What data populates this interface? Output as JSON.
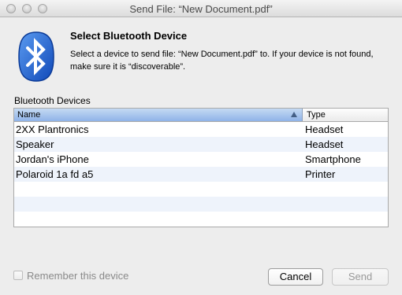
{
  "window": {
    "title": "Send File: “New Document.pdf”"
  },
  "header": {
    "heading": "Select Bluetooth Device",
    "description": "Select a device to send file: “New Document.pdf” to.  If your device is not found, make sure it is “discoverable”.",
    "icon": "bluetooth-icon"
  },
  "devices": {
    "label": "Bluetooth Devices",
    "columns": {
      "name": "Name",
      "type": "Type"
    },
    "sort": {
      "column": "name",
      "direction": "ascending",
      "icon": "sort-ascending-icon"
    },
    "rows": [
      {
        "name": "2XX Plantronics",
        "type": "Headset"
      },
      {
        "name": "Speaker",
        "type": "Headset"
      },
      {
        "name": "Jordan's iPhone",
        "type": "Smartphone"
      },
      {
        "name": "Polaroid 1a fd a5",
        "type": "Printer"
      },
      {
        "name": "",
        "type": ""
      },
      {
        "name": "",
        "type": ""
      },
      {
        "name": "",
        "type": ""
      }
    ]
  },
  "footer": {
    "remember_label": "Remember this device",
    "remember_checked": false,
    "cancel_label": "Cancel",
    "send_label": "Send",
    "send_enabled": false
  },
  "colors": {
    "bluetooth_blue": "#1c5fd1",
    "selected_header": "#8fb3e8",
    "alt_row": "#eef3fb"
  }
}
